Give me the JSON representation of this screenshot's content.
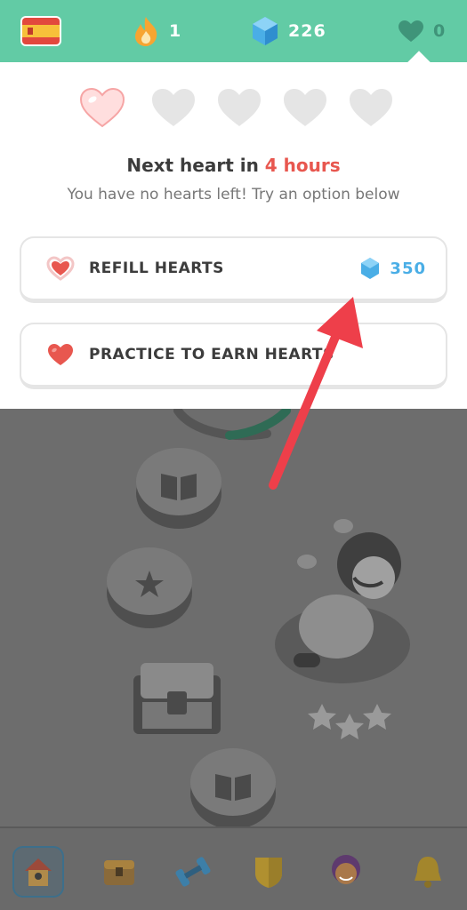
{
  "topbar": {
    "language_flag": "spain-flag-icon",
    "streak_count": "1",
    "gems_count": "226",
    "hearts_count": "0"
  },
  "popup": {
    "heading_prefix": "Next heart in ",
    "heading_highlight": "4 hours",
    "subtext": "You have no hearts left! Try an option below",
    "hearts_filled_fraction": [
      0.15,
      0,
      0,
      0,
      0
    ],
    "options": [
      {
        "label": "REFILL HEARTS",
        "cost": "350",
        "icon": "heart-icon",
        "cost_icon": "gem-icon"
      },
      {
        "label": "PRACTICE TO EARN HEARTS",
        "icon": "heart-icon"
      }
    ]
  },
  "colors": {
    "topbar_bg": "#62cba5",
    "accent_red": "#e8574f",
    "gem_blue": "#4aaee6",
    "annotation_arrow": "#ee3f4a"
  },
  "bottom_nav": [
    "home-icon",
    "chest-icon",
    "dumbbell-icon",
    "shield-icon",
    "avatar-icon",
    "bell-icon"
  ]
}
